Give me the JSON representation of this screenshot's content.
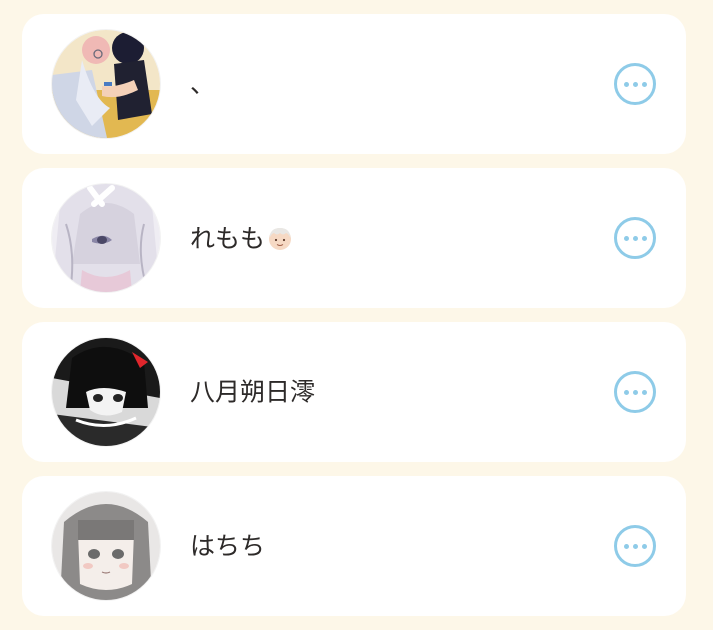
{
  "users": [
    {
      "name": "、",
      "avatar_icon": "avatar-couple-illustration",
      "emoji": ""
    },
    {
      "name": "れもも",
      "avatar_icon": "avatar-silver-hair-illustration",
      "emoji": "older-adult-face"
    },
    {
      "name": "八月朔日澪",
      "avatar_icon": "avatar-monochrome-illustration",
      "emoji": ""
    },
    {
      "name": "はちち",
      "avatar_icon": "avatar-bob-hair-illustration",
      "emoji": ""
    }
  ],
  "more_button_icon": "more-horizontal-icon",
  "colors": {
    "page_background": "#fdf7e8",
    "card_background": "#ffffff",
    "accent": "#8ecbe8",
    "text": "#2d2a29"
  }
}
